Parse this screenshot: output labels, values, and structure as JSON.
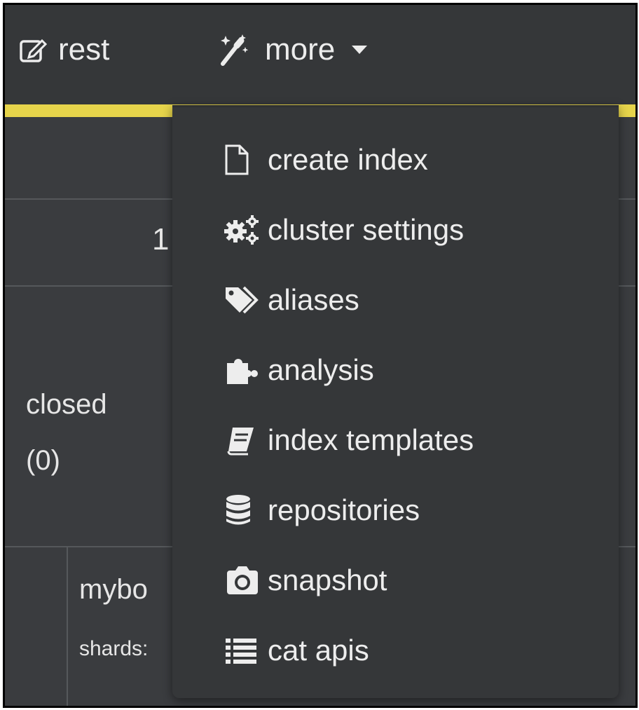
{
  "navbar": {
    "rest_label": "rest",
    "more_label": "more"
  },
  "background": {
    "number_1": "1",
    "closed_label": "closed",
    "closed_count": "(0)",
    "row_name": "mybo",
    "row_shards": "shards:"
  },
  "dropdown": {
    "items": [
      {
        "label": "create index",
        "icon": "file-icon"
      },
      {
        "label": "cluster settings",
        "icon": "cogs-icon"
      },
      {
        "label": "aliases",
        "icon": "tags-icon"
      },
      {
        "label": "analysis",
        "icon": "puzzle-icon"
      },
      {
        "label": "index templates",
        "icon": "book-icon"
      },
      {
        "label": "repositories",
        "icon": "database-icon"
      },
      {
        "label": "snapshot",
        "icon": "camera-icon"
      },
      {
        "label": "cat apis",
        "icon": "list-icon"
      }
    ]
  },
  "colors": {
    "navbar_bg": "#353739",
    "accent_yellow": "#e6d44b",
    "content_bg": "#3a3c3f",
    "text": "#ececec"
  }
}
